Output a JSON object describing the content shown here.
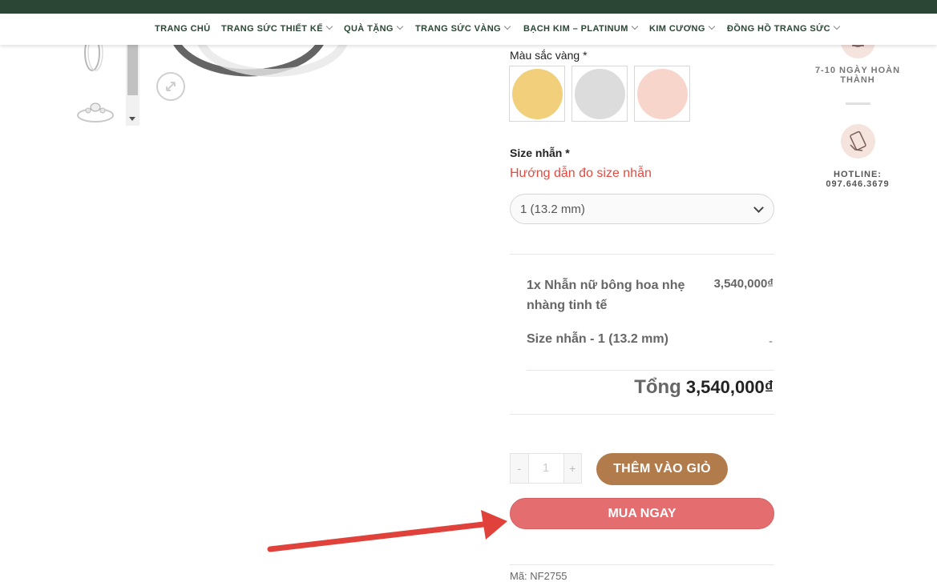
{
  "nav": {
    "items": [
      {
        "label": "TRANG CHỦ",
        "has_dropdown": false
      },
      {
        "label": "TRANG SỨC THIẾT KẾ",
        "has_dropdown": true
      },
      {
        "label": "QUÀ TẶNG",
        "has_dropdown": true
      },
      {
        "label": "TRANG SỨC VÀNG",
        "has_dropdown": true
      },
      {
        "label": "BẠCH KIM – PLATINUM",
        "has_dropdown": true
      },
      {
        "label": "KIM CƯƠNG",
        "has_dropdown": true
      },
      {
        "label": "ĐỒNG HỒ TRANG SỨC",
        "has_dropdown": true
      }
    ]
  },
  "product": {
    "color_label": "Màu sắc vàng",
    "required_mark": "*",
    "color_swatches": [
      {
        "name": "vàng",
        "color": "#f2cf7a"
      },
      {
        "name": "trắng",
        "color": "#dcdcdc"
      },
      {
        "name": "hồng",
        "color": "#f7d5cb"
      }
    ],
    "size_label": "Size nhẫn",
    "size_guide_link": "Hướng dẫn đo size nhẫn",
    "size_selected": "1 (13.2 mm)",
    "summary": {
      "item_name": "1x Nhẫn nữ bông hoa nhẹ nhàng tinh tế",
      "item_price": "3,540,000₫",
      "size_line": "Size nhẫn - 1 (13.2 mm)",
      "size_price": "-",
      "total_label": "Tổng",
      "total_value": "3,540,000₫"
    },
    "quantity": {
      "minus": "-",
      "value": "1",
      "plus": "+"
    },
    "add_to_cart": "THÊM VÀO GIỎ",
    "buy_now": "MUA NGAY",
    "sku": "Mã: NF2755"
  },
  "sidebar": {
    "delivery_text": "7-10 NGÀY HOÀN THÀNH",
    "hotline_label": "HOTLINE:",
    "hotline_number": "097.646.3679"
  },
  "colors": {
    "header_green": "#2b4634",
    "cart_button": "#b27b4c",
    "buy_button": "#e46e6f",
    "link_red": "#e7493f",
    "annotation_arrow": "#e0413a"
  },
  "icons": [
    "chevron-down-icon",
    "zoom-icon",
    "jewelry-box-icon",
    "phone-hand-icon",
    "select-arrow-icon"
  ]
}
